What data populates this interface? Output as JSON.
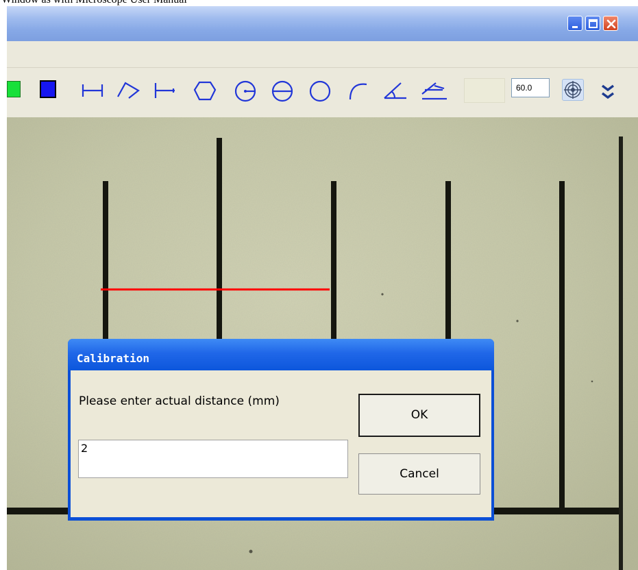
{
  "document": {
    "header_text": "Window   as   with Microscope User Manual"
  },
  "window": {
    "title_buttons": [
      "minimize-button",
      "maximize-button",
      "close-button"
    ]
  },
  "toolbar": {
    "colors": {
      "green": "#18e03a",
      "blue": "#1616f0"
    },
    "tools": [
      "horizontal-line-tool",
      "polygon-line-tool",
      "perpendicular-line-tool",
      "polygon-tool",
      "circle-radius-tool",
      "circle-diameter-tool",
      "three-point-circle-tool",
      "arc-tool",
      "angle-tool",
      "four-point-angle-tool"
    ],
    "line_width_value": "60.0"
  },
  "measurement": {
    "line_color": "#ff0000"
  },
  "dialog": {
    "title": "Calibration",
    "prompt": "Please enter actual distance (mm)",
    "input_value": "2",
    "ok_label": "OK",
    "cancel_label": "Cancel"
  }
}
